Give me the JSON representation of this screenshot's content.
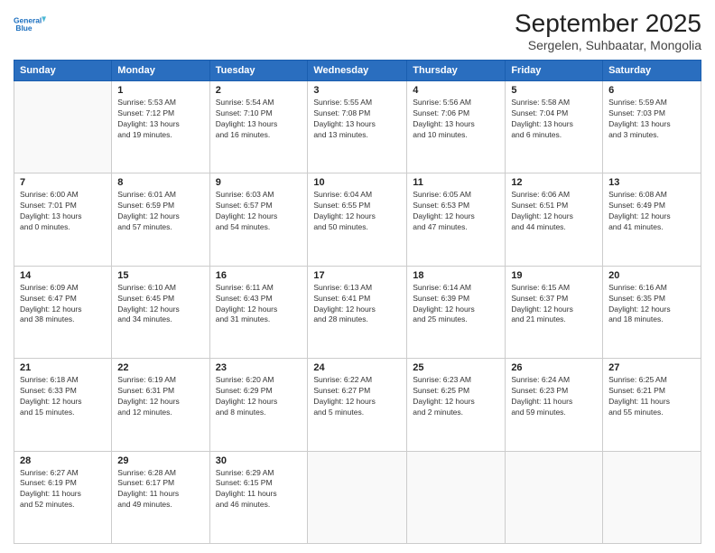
{
  "logo": {
    "line1": "General",
    "line2": "Blue"
  },
  "title": "September 2025",
  "subtitle": "Sergelen, Suhbaatar, Mongolia",
  "days_of_week": [
    "Sunday",
    "Monday",
    "Tuesday",
    "Wednesday",
    "Thursday",
    "Friday",
    "Saturday"
  ],
  "weeks": [
    [
      {
        "num": "",
        "detail": ""
      },
      {
        "num": "1",
        "detail": "Sunrise: 5:53 AM\nSunset: 7:12 PM\nDaylight: 13 hours\nand 19 minutes."
      },
      {
        "num": "2",
        "detail": "Sunrise: 5:54 AM\nSunset: 7:10 PM\nDaylight: 13 hours\nand 16 minutes."
      },
      {
        "num": "3",
        "detail": "Sunrise: 5:55 AM\nSunset: 7:08 PM\nDaylight: 13 hours\nand 13 minutes."
      },
      {
        "num": "4",
        "detail": "Sunrise: 5:56 AM\nSunset: 7:06 PM\nDaylight: 13 hours\nand 10 minutes."
      },
      {
        "num": "5",
        "detail": "Sunrise: 5:58 AM\nSunset: 7:04 PM\nDaylight: 13 hours\nand 6 minutes."
      },
      {
        "num": "6",
        "detail": "Sunrise: 5:59 AM\nSunset: 7:03 PM\nDaylight: 13 hours\nand 3 minutes."
      }
    ],
    [
      {
        "num": "7",
        "detail": "Sunrise: 6:00 AM\nSunset: 7:01 PM\nDaylight: 13 hours\nand 0 minutes."
      },
      {
        "num": "8",
        "detail": "Sunrise: 6:01 AM\nSunset: 6:59 PM\nDaylight: 12 hours\nand 57 minutes."
      },
      {
        "num": "9",
        "detail": "Sunrise: 6:03 AM\nSunset: 6:57 PM\nDaylight: 12 hours\nand 54 minutes."
      },
      {
        "num": "10",
        "detail": "Sunrise: 6:04 AM\nSunset: 6:55 PM\nDaylight: 12 hours\nand 50 minutes."
      },
      {
        "num": "11",
        "detail": "Sunrise: 6:05 AM\nSunset: 6:53 PM\nDaylight: 12 hours\nand 47 minutes."
      },
      {
        "num": "12",
        "detail": "Sunrise: 6:06 AM\nSunset: 6:51 PM\nDaylight: 12 hours\nand 44 minutes."
      },
      {
        "num": "13",
        "detail": "Sunrise: 6:08 AM\nSunset: 6:49 PM\nDaylight: 12 hours\nand 41 minutes."
      }
    ],
    [
      {
        "num": "14",
        "detail": "Sunrise: 6:09 AM\nSunset: 6:47 PM\nDaylight: 12 hours\nand 38 minutes."
      },
      {
        "num": "15",
        "detail": "Sunrise: 6:10 AM\nSunset: 6:45 PM\nDaylight: 12 hours\nand 34 minutes."
      },
      {
        "num": "16",
        "detail": "Sunrise: 6:11 AM\nSunset: 6:43 PM\nDaylight: 12 hours\nand 31 minutes."
      },
      {
        "num": "17",
        "detail": "Sunrise: 6:13 AM\nSunset: 6:41 PM\nDaylight: 12 hours\nand 28 minutes."
      },
      {
        "num": "18",
        "detail": "Sunrise: 6:14 AM\nSunset: 6:39 PM\nDaylight: 12 hours\nand 25 minutes."
      },
      {
        "num": "19",
        "detail": "Sunrise: 6:15 AM\nSunset: 6:37 PM\nDaylight: 12 hours\nand 21 minutes."
      },
      {
        "num": "20",
        "detail": "Sunrise: 6:16 AM\nSunset: 6:35 PM\nDaylight: 12 hours\nand 18 minutes."
      }
    ],
    [
      {
        "num": "21",
        "detail": "Sunrise: 6:18 AM\nSunset: 6:33 PM\nDaylight: 12 hours\nand 15 minutes."
      },
      {
        "num": "22",
        "detail": "Sunrise: 6:19 AM\nSunset: 6:31 PM\nDaylight: 12 hours\nand 12 minutes."
      },
      {
        "num": "23",
        "detail": "Sunrise: 6:20 AM\nSunset: 6:29 PM\nDaylight: 12 hours\nand 8 minutes."
      },
      {
        "num": "24",
        "detail": "Sunrise: 6:22 AM\nSunset: 6:27 PM\nDaylight: 12 hours\nand 5 minutes."
      },
      {
        "num": "25",
        "detail": "Sunrise: 6:23 AM\nSunset: 6:25 PM\nDaylight: 12 hours\nand 2 minutes."
      },
      {
        "num": "26",
        "detail": "Sunrise: 6:24 AM\nSunset: 6:23 PM\nDaylight: 11 hours\nand 59 minutes."
      },
      {
        "num": "27",
        "detail": "Sunrise: 6:25 AM\nSunset: 6:21 PM\nDaylight: 11 hours\nand 55 minutes."
      }
    ],
    [
      {
        "num": "28",
        "detail": "Sunrise: 6:27 AM\nSunset: 6:19 PM\nDaylight: 11 hours\nand 52 minutes."
      },
      {
        "num": "29",
        "detail": "Sunrise: 6:28 AM\nSunset: 6:17 PM\nDaylight: 11 hours\nand 49 minutes."
      },
      {
        "num": "30",
        "detail": "Sunrise: 6:29 AM\nSunset: 6:15 PM\nDaylight: 11 hours\nand 46 minutes."
      },
      {
        "num": "",
        "detail": ""
      },
      {
        "num": "",
        "detail": ""
      },
      {
        "num": "",
        "detail": ""
      },
      {
        "num": "",
        "detail": ""
      }
    ]
  ]
}
